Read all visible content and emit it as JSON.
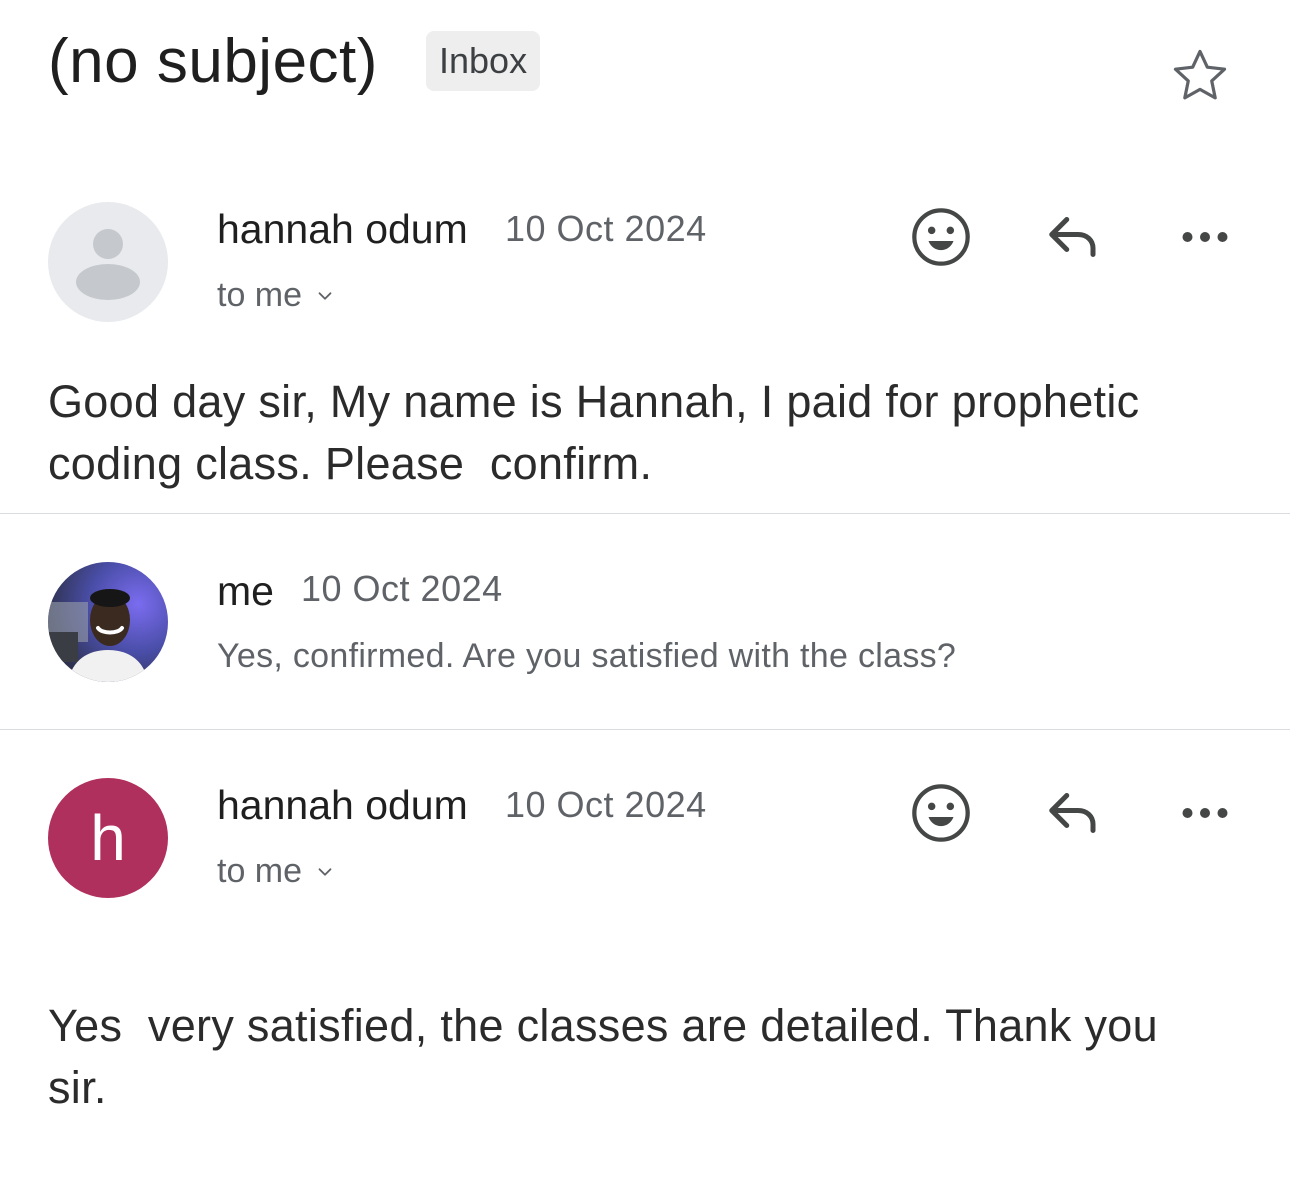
{
  "thread": {
    "subject": "(no subject)",
    "label": "Inbox"
  },
  "messages": [
    {
      "sender": "hannah odum",
      "date": "10 Oct 2024",
      "recipient": "to me",
      "body": "Good day sir, My name is Hannah, I paid for prophetic coding class. Please  confirm.",
      "avatar_style": "default-person"
    },
    {
      "sender": "me",
      "date": "10 Oct 2024",
      "snippet": "Yes, confirmed. Are you satisfied with the class?",
      "avatar_style": "photo"
    },
    {
      "sender": "hannah odum",
      "date": "10 Oct 2024",
      "recipient": "to me",
      "body": "Yes  very satisfied, the classes are detailed. Thank you sir.",
      "avatar_letter": "h",
      "avatar_color": "#b0305d"
    }
  ],
  "icons": {
    "star": "star-outline-icon",
    "emoji": "smiley-icon",
    "reply": "reply-icon",
    "more": "more-horizontal-icon",
    "expand": "chevron-down-icon"
  }
}
